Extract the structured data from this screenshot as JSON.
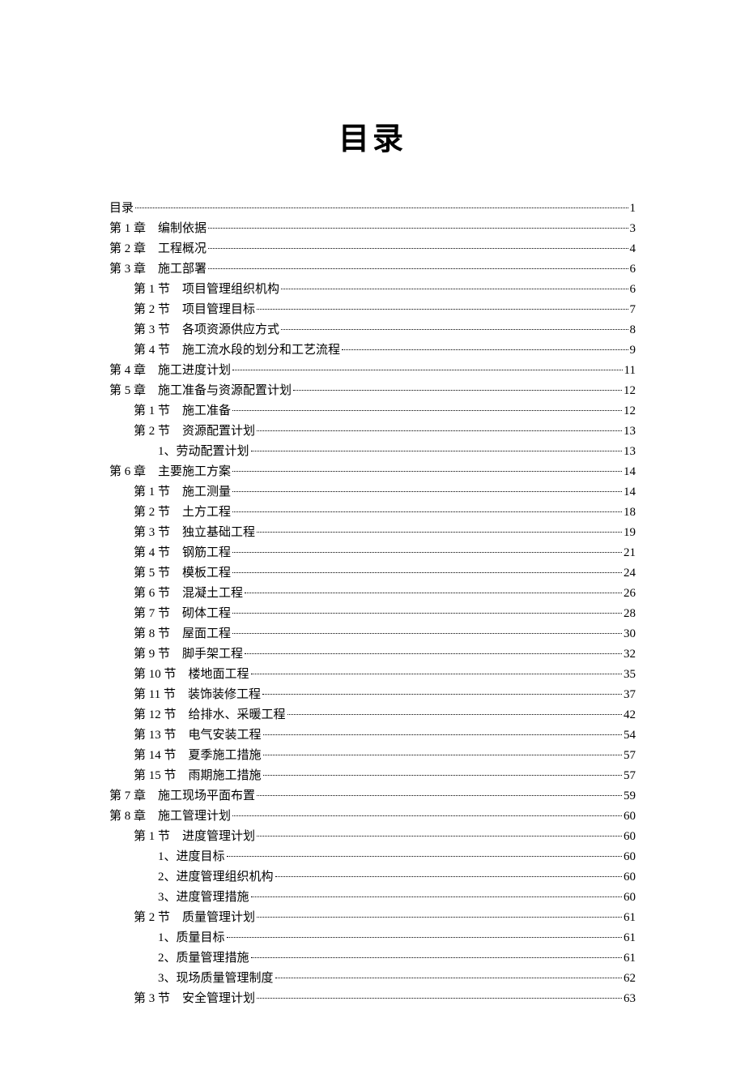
{
  "title": "目录",
  "toc": [
    {
      "level": 0,
      "label": "目录",
      "page": "1"
    },
    {
      "level": 0,
      "label": "第 1 章　编制依据",
      "page": "3"
    },
    {
      "level": 0,
      "label": "第 2 章　工程概况",
      "page": "4"
    },
    {
      "level": 0,
      "label": "第 3 章　施工部署",
      "page": "6"
    },
    {
      "level": 1,
      "label": "第 1 节　项目管理组织机构",
      "page": "6"
    },
    {
      "level": 1,
      "label": "第 2 节　项目管理目标",
      "page": "7"
    },
    {
      "level": 1,
      "label": "第 3 节　各项资源供应方式",
      "page": "8"
    },
    {
      "level": 1,
      "label": "第 4 节　施工流水段的划分和工艺流程",
      "page": "9"
    },
    {
      "level": 0,
      "label": "第 4 章　施工进度计划",
      "page": "11"
    },
    {
      "level": 0,
      "label": "第 5 章　施工准备与资源配置计划",
      "page": "12"
    },
    {
      "level": 1,
      "label": "第 1 节　施工准备",
      "page": "12"
    },
    {
      "level": 1,
      "label": "第 2 节　资源配置计划",
      "page": "13"
    },
    {
      "level": 2,
      "label": "1、劳动配置计划",
      "page": "13"
    },
    {
      "level": 0,
      "label": "第 6 章　主要施工方案",
      "page": "14"
    },
    {
      "level": 1,
      "label": "第 1 节　施工测量",
      "page": "14"
    },
    {
      "level": 1,
      "label": "第 2 节　土方工程",
      "page": "18"
    },
    {
      "level": 1,
      "label": "第 3 节　独立基础工程",
      "page": "19"
    },
    {
      "level": 1,
      "label": "第 4 节　钢筋工程",
      "page": "21"
    },
    {
      "level": 1,
      "label": "第 5 节　模板工程",
      "page": "24"
    },
    {
      "level": 1,
      "label": "第 6 节　混凝土工程",
      "page": "26"
    },
    {
      "level": 1,
      "label": "第 7 节　砌体工程",
      "page": "28"
    },
    {
      "level": 1,
      "label": "第 8 节　屋面工程",
      "page": "30"
    },
    {
      "level": 1,
      "label": "第 9 节　脚手架工程",
      "page": "32"
    },
    {
      "level": 1,
      "label": "第 10 节　楼地面工程",
      "page": "35"
    },
    {
      "level": 1,
      "label": "第 11 节　装饰装修工程",
      "page": "37"
    },
    {
      "level": 1,
      "label": "第 12 节　给排水、采暖工程",
      "page": "42"
    },
    {
      "level": 1,
      "label": "第 13 节　电气安装工程",
      "page": "54"
    },
    {
      "level": 1,
      "label": "第 14 节　夏季施工措施",
      "page": "57"
    },
    {
      "level": 1,
      "label": "第 15 节　雨期施工措施",
      "page": "57"
    },
    {
      "level": 0,
      "label": "第 7 章　施工现场平面布置",
      "page": "59"
    },
    {
      "level": 0,
      "label": "第 8 章　施工管理计划",
      "page": "60"
    },
    {
      "level": 1,
      "label": "第 1 节　进度管理计划",
      "page": "60"
    },
    {
      "level": 2,
      "label": "1、进度目标",
      "page": "60"
    },
    {
      "level": 2,
      "label": "2、进度管理组织机构",
      "page": "60"
    },
    {
      "level": 2,
      "label": "3、进度管理措施",
      "page": "60"
    },
    {
      "level": 1,
      "label": "第 2 节　质量管理计划",
      "page": "61"
    },
    {
      "level": 2,
      "label": "1、质量目标",
      "page": "61"
    },
    {
      "level": 2,
      "label": "2、质量管理措施",
      "page": "61"
    },
    {
      "level": 2,
      "label": "3、现场质量管理制度",
      "page": "62"
    },
    {
      "level": 1,
      "label": "第 3 节　安全管理计划",
      "page": "63"
    }
  ]
}
